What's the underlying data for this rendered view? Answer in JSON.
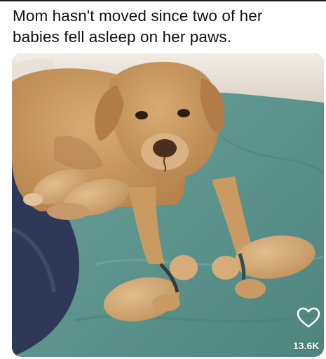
{
  "post": {
    "caption_line1": "Mom hasn't moved since two of her",
    "caption_line2": "babies fell asleep on her paws.",
    "like_count": "13.6K",
    "like_icon": "heart-outline-icon"
  },
  "colors": {
    "blanket_green": "#5f9892",
    "blanket_navy": "#2f3a57",
    "dog_fur": "#c7955c",
    "puppy_fur": "#d3a873",
    "wall": "#ece6df"
  }
}
